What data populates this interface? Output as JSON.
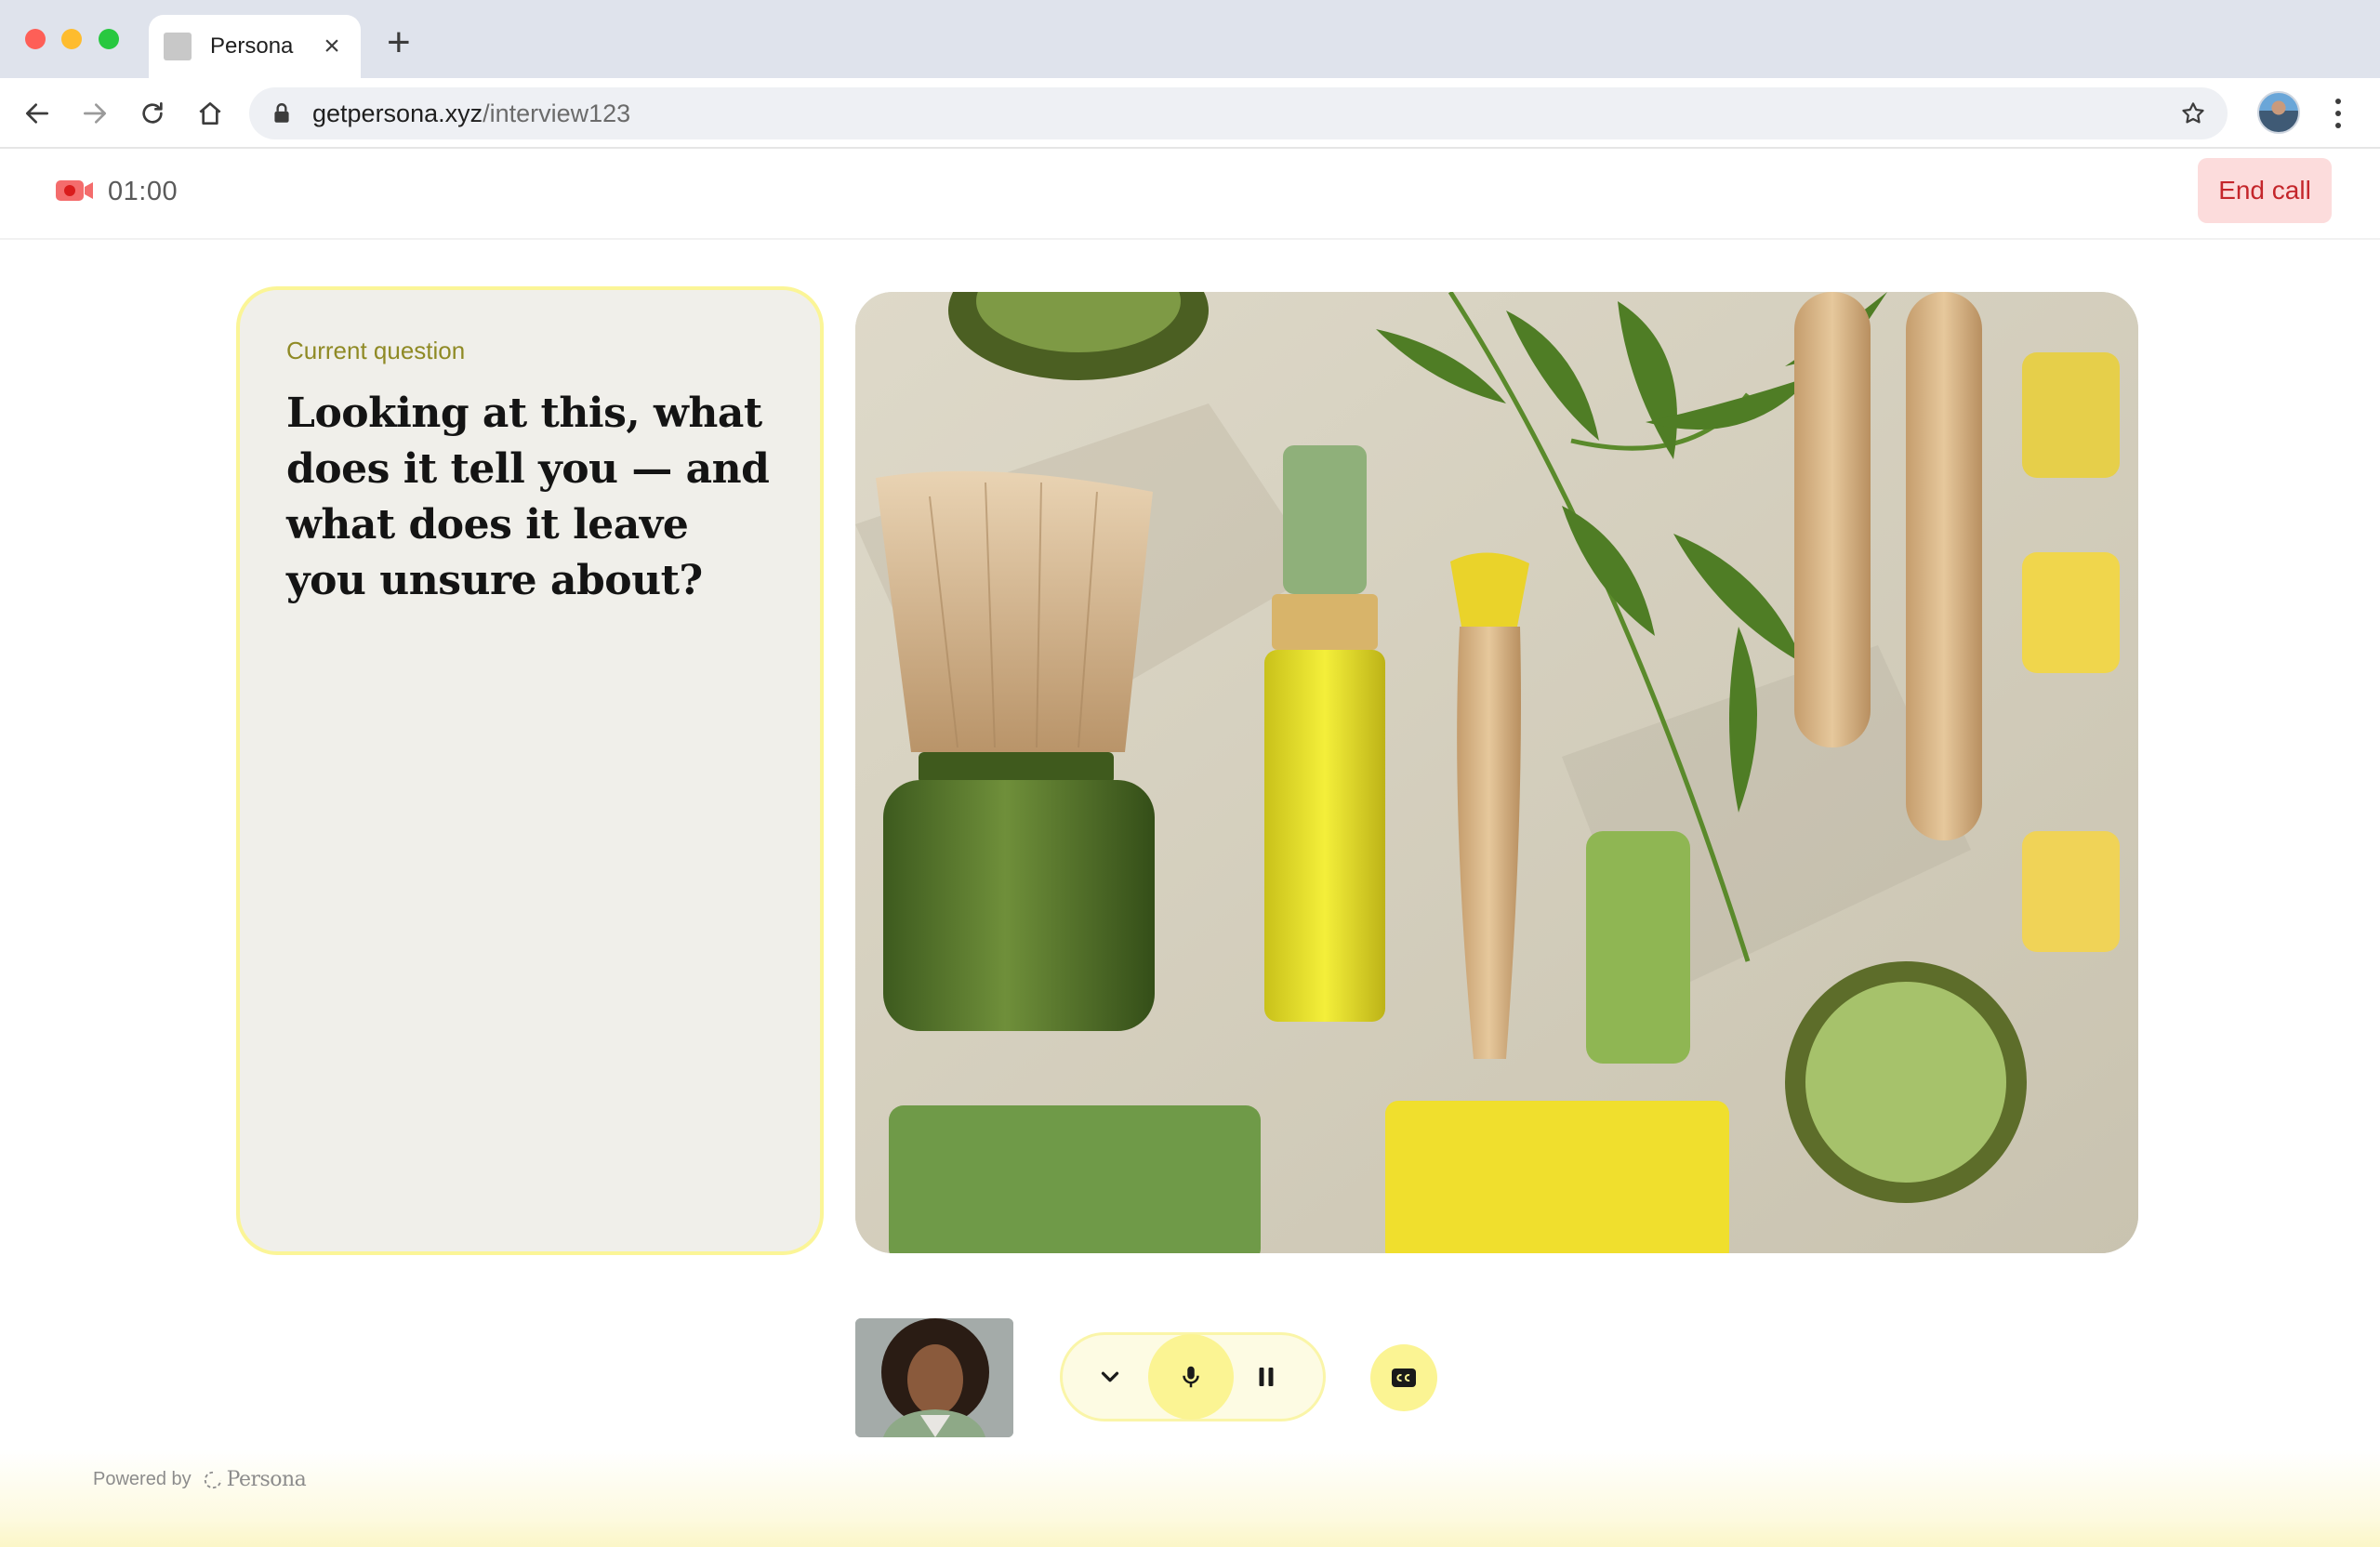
{
  "browser": {
    "tab_title": "Persona",
    "tab_close": "×",
    "new_tab": "+",
    "url_host": "getpersona.xyz",
    "url_path": "/interview123"
  },
  "call": {
    "timer": "01:00",
    "end_call_label": "End call"
  },
  "question": {
    "label": "Current question",
    "text": "Looking at this, what does it tell you — and what does it leave you unsure about?"
  },
  "controls": {
    "icons": [
      "chevron-down-icon",
      "microphone-icon",
      "pause-icon",
      "closed-captions-icon"
    ],
    "mic_active": true
  },
  "footer": {
    "powered_by": "Powered by",
    "brand": "Persona"
  },
  "colors": {
    "accent_yellow": "#fbf493",
    "card_border": "#fbf597",
    "end_call_bg": "#fcdcdc",
    "end_call_text": "#c4262b",
    "record_red": "#f05a5a"
  }
}
